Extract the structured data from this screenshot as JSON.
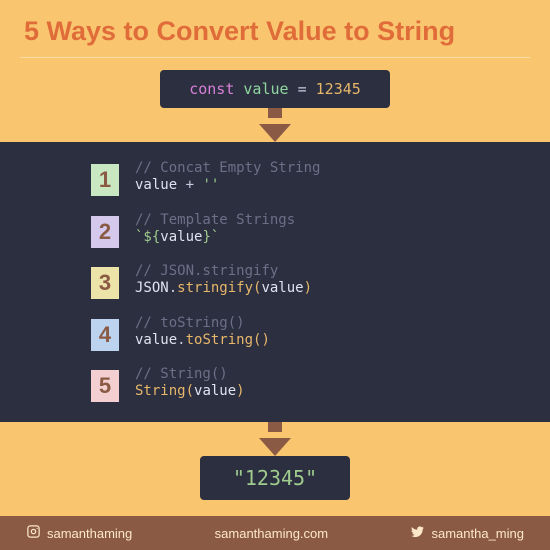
{
  "title": "5 Ways to Convert Value to String",
  "declaration": {
    "keyword": "const",
    "varname": "value",
    "equals": "=",
    "number": "12345"
  },
  "methods": [
    {
      "num": "1",
      "comment": "// Concat Empty String",
      "code_html": "value <span class='tok-dot'>+</span> <span class='tok-str'>''</span>"
    },
    {
      "num": "2",
      "comment": "// Template Strings",
      "code_html": "<span class='tok-str'>`${</span>value<span class='tok-str'>}`</span>"
    },
    {
      "num": "3",
      "comment": "// JSON.stringify",
      "code_html": "JSON<span class='tok-dot'>.</span><span class='tok-fn'>stringify</span><span class='tok-paren'>(</span>value<span class='tok-paren'>)</span>"
    },
    {
      "num": "4",
      "comment": "// toString()",
      "code_html": "value<span class='tok-dot'>.</span><span class='tok-fn'>toString</span><span class='tok-paren'>(</span><span class='tok-paren'>)</span>"
    },
    {
      "num": "5",
      "comment": "// String()",
      "code_html": "<span class='tok-fn'>String</span><span class='tok-paren'>(</span>value<span class='tok-paren'>)</span>"
    }
  ],
  "result": "\"12345\"",
  "footer": {
    "instagram": "samanthaming",
    "website": "samanthaming.com",
    "twitter": "samantha_ming"
  }
}
